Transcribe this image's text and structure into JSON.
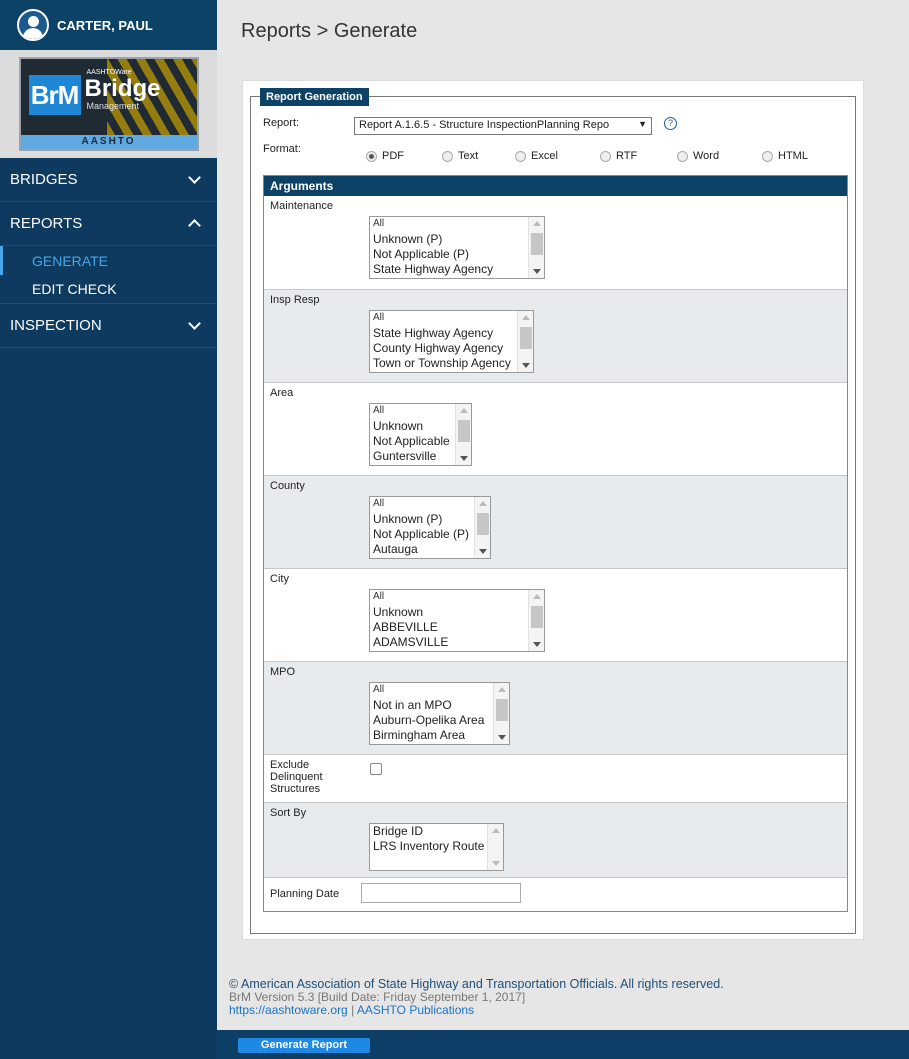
{
  "user": {
    "name": "CARTER, PAUL"
  },
  "logo": {
    "brm": "BrM",
    "aashtoware": "AASHTOWare",
    "bridge": "Bridge",
    "management": "Management",
    "aashto": "AASHTO"
  },
  "sidebar": {
    "items": [
      {
        "label": "BRIDGES",
        "expanded": false
      },
      {
        "label": "REPORTS",
        "expanded": true,
        "children": [
          {
            "label": "GENERATE",
            "active": true
          },
          {
            "label": "EDIT CHECK",
            "active": false
          }
        ]
      },
      {
        "label": "INSPECTION",
        "expanded": false
      }
    ]
  },
  "header": {
    "title": "Reports > Generate"
  },
  "report_generation": {
    "legend": "Report Generation",
    "report_label": "Report:",
    "report_value": "Report A.1.6.5 - Structure InspectionPlanning Repo",
    "format_label": "Format:",
    "formats": [
      "PDF",
      "Text",
      "Excel",
      "RTF",
      "Word",
      "HTML"
    ],
    "format_selected": "PDF"
  },
  "arguments": {
    "header": "Arguments",
    "maintenance": {
      "label": "Maintenance",
      "options": [
        "All",
        "Unknown (P)",
        "Not Applicable (P)",
        "State Highway Agency"
      ]
    },
    "insp_resp": {
      "label": "Insp Resp",
      "options": [
        "All",
        "State Highway Agency",
        "County Highway Agency",
        "Town or Township Agency"
      ]
    },
    "area": {
      "label": "Area",
      "options": [
        "All",
        "Unknown",
        "Not Applicable",
        "Guntersville"
      ]
    },
    "county": {
      "label": "County",
      "options": [
        "All",
        "Unknown (P)",
        "Not Applicable (P)",
        "Autauga"
      ]
    },
    "city": {
      "label": "City",
      "options": [
        "All",
        "Unknown",
        "ABBEVILLE",
        "ADAMSVILLE"
      ]
    },
    "mpo": {
      "label": "MPO",
      "options": [
        "All",
        "Not in an MPO",
        "Auburn-Opelika Area",
        "Birmingham Area"
      ]
    },
    "exclude": {
      "label_1": "Exclude",
      "label_2": "Delinquent",
      "label_3": "Structures",
      "checked": false
    },
    "sort_by": {
      "label": "Sort By",
      "options": [
        "Bridge ID",
        "LRS Inventory Route"
      ]
    },
    "planning_date": {
      "label": "Planning Date",
      "value": ""
    }
  },
  "footer": {
    "copyright": "© American Association of State Highway and Transportation Officials. All rights reserved.",
    "version": "BrM Version 5.3 [Build Date: Friday September 1, 2017]",
    "link1": "https://aashtoware.org",
    "separator": "|",
    "link2": "AASHTO Publications"
  },
  "actions": {
    "generate_label": "Generate Report"
  }
}
